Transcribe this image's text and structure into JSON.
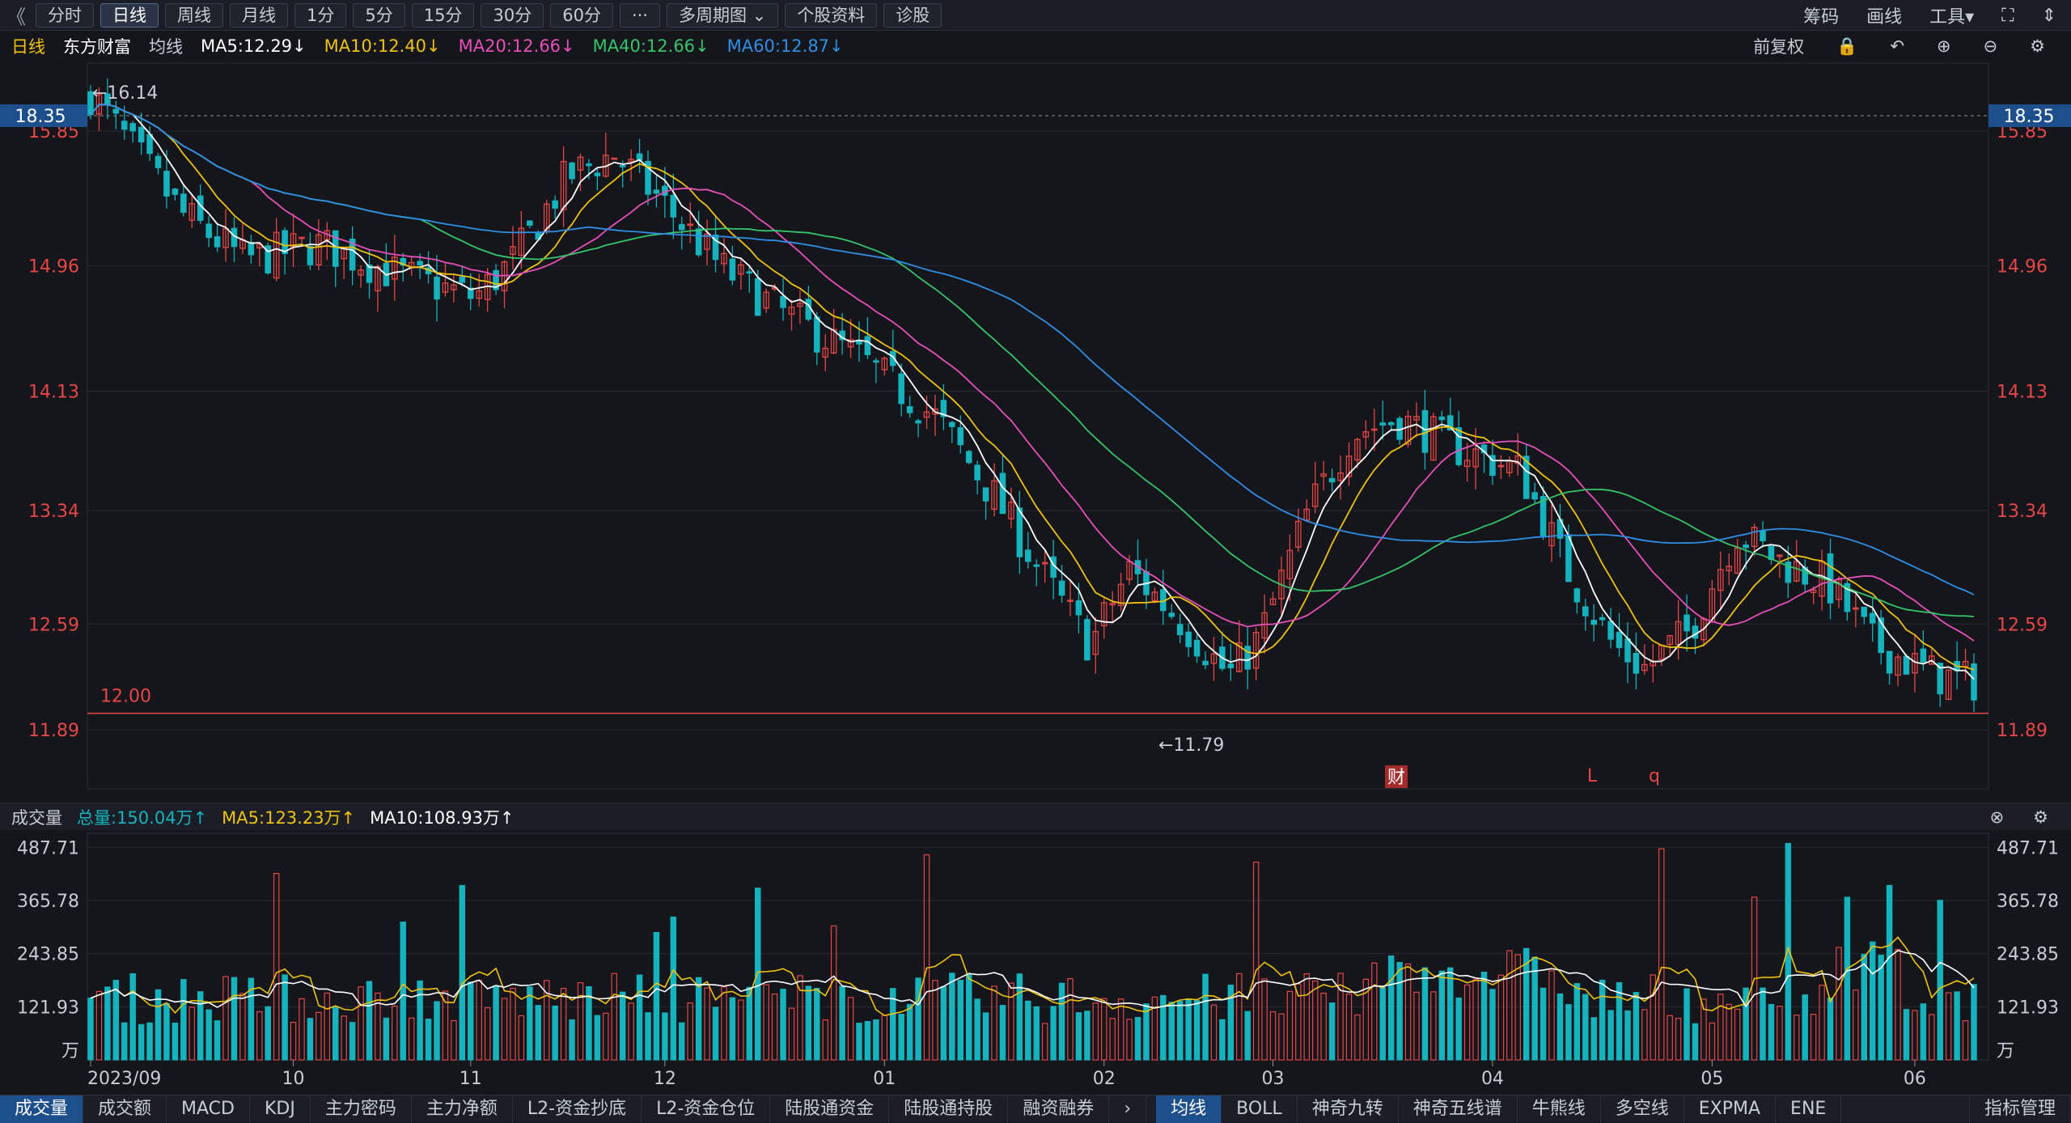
{
  "toolbar": {
    "nav_left": "《",
    "periods": [
      "分时",
      "日线",
      "周线",
      "月线",
      "1分",
      "5分",
      "15分",
      "30分",
      "60分",
      "···",
      "多周期图 ⌄",
      "个股资料",
      "诊股"
    ],
    "active_period": "日线",
    "right_items": [
      "筹码",
      "画线",
      "工具▾",
      "⛶",
      "⇕"
    ]
  },
  "main_header": {
    "period": "日线",
    "stock": "东方财富",
    "ma_label": "均线",
    "ma5": "MA5:12.29↓",
    "ma10": "MA10:12.40↓",
    "ma20": "MA20:12.66↓",
    "ma40": "MA40:12.66↓",
    "ma60": "MA60:12.87↓",
    "adjust": "前复权"
  },
  "vol_header": {
    "title": "成交量",
    "total": "总量:150.04万↑",
    "ma5": "MA5:123.23万↑",
    "ma10": "MA10:108.93万↑"
  },
  "bottom_tabs_left": [
    "成交量",
    "成交额",
    "MACD",
    "KDJ",
    "主力密码",
    "主力净额",
    "L2-资金抄底",
    "L2-资金仓位",
    "陆股通资金",
    "陆股通持股",
    "融资融券"
  ],
  "bottom_tabs_right": [
    "均线",
    "BOLL",
    "神奇九转",
    "神奇五线谱",
    "牛熊线",
    "多空线",
    "EXPMA",
    "ENE"
  ],
  "bottom_tab_more": "指标管理",
  "colors": {
    "up": "#e64646",
    "down": "#14b3be",
    "ma5": "#ffffff",
    "ma10": "#f0c20e",
    "ma20": "#e84fb9",
    "ma40": "#36c46a",
    "ma60": "#2f8fe6"
  },
  "chart_data": [
    {
      "type": "candlestick",
      "title": "",
      "y_ticks": [
        15.85,
        14.96,
        14.13,
        13.34,
        12.59,
        11.89
      ],
      "ylim": [
        11.5,
        16.3
      ],
      "current_price_label": "18.35",
      "annotations": {
        "high": "←16.14",
        "low": "←11.79",
        "hline": "12.00",
        "markers": [
          "财",
          "L",
          "q"
        ]
      },
      "x_ticks": [
        "2023/09",
        "10",
        "11",
        "12",
        "01",
        "02",
        "03",
        "04",
        "05",
        "06"
      ],
      "series": [
        {
          "name": "MA5"
        },
        {
          "name": "MA10"
        },
        {
          "name": "MA20"
        },
        {
          "name": "MA40"
        },
        {
          "name": "MA60"
        }
      ]
    },
    {
      "type": "bar",
      "title": "成交量",
      "y_ticks": [
        "487.71",
        "365.78",
        "243.85",
        "121.93",
        "万"
      ],
      "ylim": [
        0,
        520
      ]
    }
  ]
}
